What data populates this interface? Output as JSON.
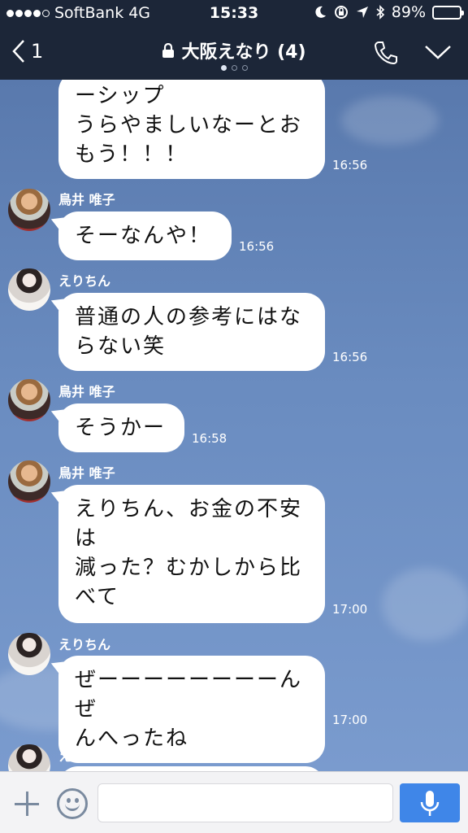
{
  "status_bar": {
    "carrier": "SoftBank",
    "network": "4G",
    "time": "15:33",
    "battery": "89%",
    "battery_level": 0.89,
    "icons": [
      "moon-icon",
      "rotation-lock-icon",
      "location-icon",
      "bluetooth-icon"
    ]
  },
  "nav": {
    "back_count": "1",
    "title": "大阪えなり (4)",
    "page_dots": 3,
    "active_dot": 0
  },
  "messages": [
    {
      "sender": "",
      "avatar": "",
      "text": "ーシップ\nうらやましいなーとお\nもう！！！",
      "time": "16:56"
    },
    {
      "sender": "鳥井 唯子",
      "avatar": "torii",
      "text": "そーなんや！",
      "time": "16:56"
    },
    {
      "sender": "えりちん",
      "avatar": "eri",
      "text": "普通の人の参考にはな\nらない笑",
      "time": "16:56"
    },
    {
      "sender": "鳥井 唯子",
      "avatar": "torii",
      "text": "そうかー",
      "time": "16:58"
    },
    {
      "sender": "鳥井 唯子",
      "avatar": "torii",
      "text": "えりちん、お金の不安\nは\n減った？むかしから比\nべて",
      "time": "17:00"
    },
    {
      "sender": "えりちん",
      "avatar": "eri",
      "text": "ぜーーーーーーーーんぜ\nんへったね",
      "time": "17:00"
    },
    {
      "sender": "えりちん",
      "avatar": "eri",
      "text": "",
      "time": ""
    }
  ],
  "input": {
    "placeholder": "",
    "value": ""
  },
  "colors": {
    "nav_bg": "#1c2638",
    "chat_bg": "#6a8cc0",
    "mic_button": "#3f86e8"
  }
}
